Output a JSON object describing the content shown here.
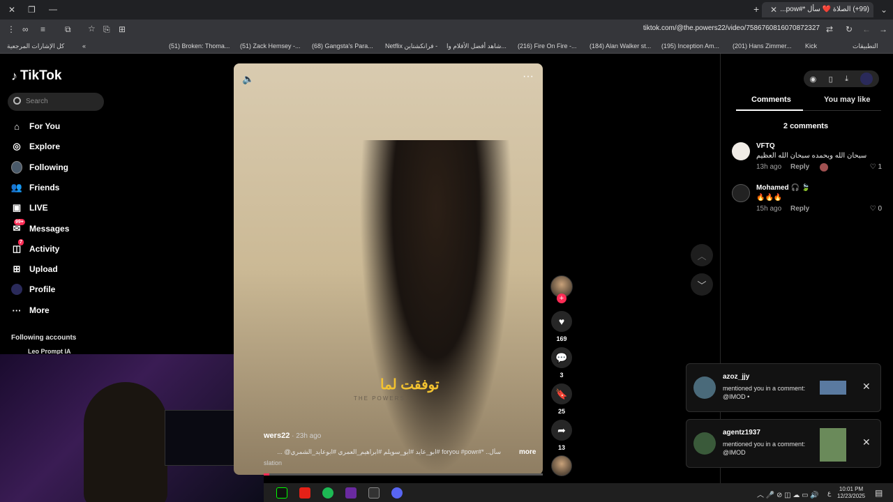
{
  "browser": {
    "tab_title": "(99+) الصلاة ❤️ سأل *#pow...",
    "url": "tiktok.com/@the.powers22/video/7586760816070872327",
    "bookmarks": [
      "(51) Broken: Thoma...",
      "(51) Zack Hemsey -...",
      "(68) Gangsta's Para...",
      "Netflix فرانكشتاين -",
      "شاهد أفضل الأفلام وا...",
      "(216) Fire On Fire -...",
      "(184) Alan Walker st...",
      "(195) Inception Am...",
      "(201) Hans Zimmer...",
      "Kick"
    ],
    "bookmarks_right": "التطبيقات",
    "bookmarks_left": "كل الإشارات المرجعية"
  },
  "sidebar": {
    "logo": "TikTok",
    "search_placeholder": "Search",
    "items": [
      {
        "label": "For You",
        "icon": "home-icon"
      },
      {
        "label": "Explore",
        "icon": "compass-icon"
      },
      {
        "label": "Following",
        "icon": "following-avatar-icon"
      },
      {
        "label": "Friends",
        "icon": "friends-icon"
      },
      {
        "label": "LIVE",
        "icon": "live-icon"
      },
      {
        "label": "Messages",
        "icon": "messages-icon",
        "badge": "99+"
      },
      {
        "label": "Activity",
        "icon": "activity-icon",
        "badge": "7"
      },
      {
        "label": "Upload",
        "icon": "upload-icon"
      },
      {
        "label": "Profile",
        "icon": "profile-icon"
      },
      {
        "label": "More",
        "icon": "more-icon"
      }
    ],
    "following_title": "Following accounts",
    "following_first": "Leo Prompt IA"
  },
  "video": {
    "caption_ar": "توفقت لما",
    "caption_en": "THE POWERS",
    "author": "wers22",
    "time": " · 23h ago",
    "description": "سأل.. *#foryou #powr #ابو_عايد #ابو_سويلم #ابراهيم_العمري #ابوعايد_الشمري@ ...",
    "more": "more",
    "translation": "slation",
    "progress": 0.02
  },
  "actions": {
    "likes": "169",
    "comments": "3",
    "saves": "25",
    "shares": "13"
  },
  "panel": {
    "tab_comments": "Comments",
    "tab_like": "You may like",
    "comments_count": "2 comments",
    "comments": [
      {
        "name": "VFTQ",
        "text": "سبحان الله وبحمده سبحان الله العظيم",
        "time": "13h ago",
        "reply": "Reply",
        "likes": "1"
      },
      {
        "name": "Mohamed 🎧 🍃",
        "text": "🔥🔥🔥",
        "time": "15h ago",
        "reply": "Reply",
        "likes": "0"
      }
    ]
  },
  "notifications": [
    {
      "name": "azoz_jjy",
      "text": "mentioned you in a comment: @IMOD •"
    },
    {
      "name": "agentz1937",
      "text": "mentioned you in a comment: @IMOD"
    }
  ],
  "taskbar": {
    "time": "10:01 PM",
    "date": "12/23/2025",
    "lang": "ع"
  },
  "colors": {
    "accent": "#fe2c55",
    "background": "#000000"
  }
}
